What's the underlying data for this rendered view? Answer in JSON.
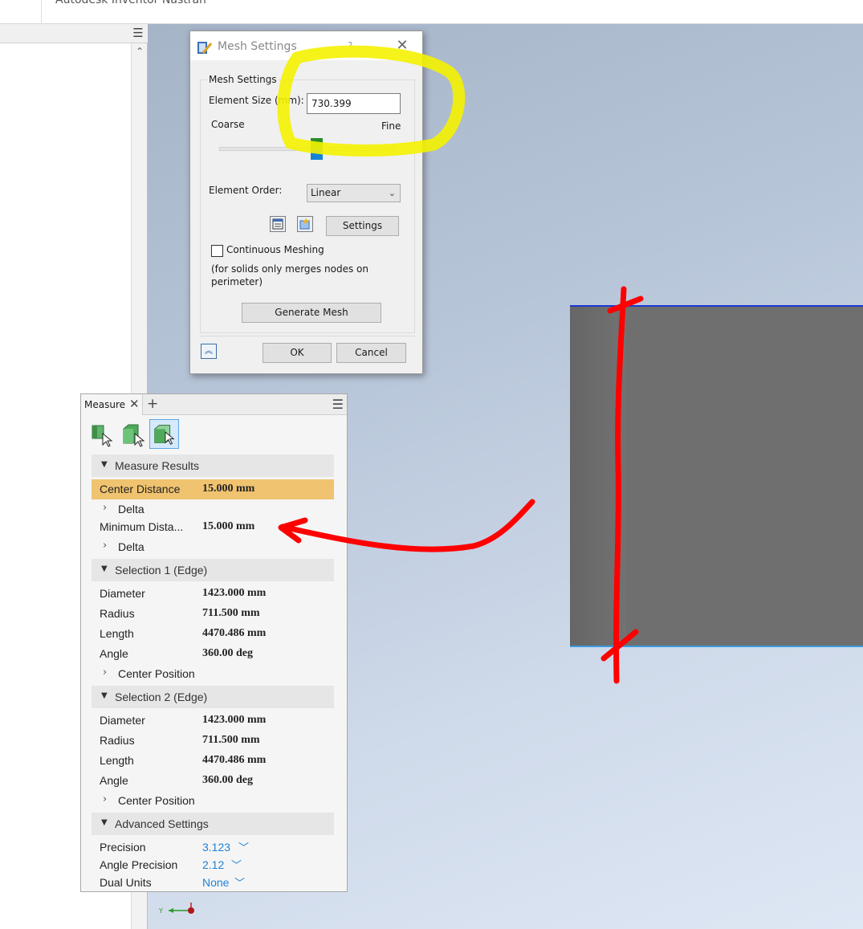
{
  "app": {
    "title": "Autodesk Inventor Nastran"
  },
  "browser": {
    "menu_icon": "hamburger-icon",
    "scroll_up_icon": "chevron-up-icon"
  },
  "mesh_dialog": {
    "title": "Mesh Settings",
    "help": "?",
    "group_label": "Mesh Settings",
    "element_size_label": "Element Size (mm):",
    "element_size_value": "730.399",
    "coarse_label": "Coarse",
    "fine_label": "Fine",
    "slider_level_percent": 55,
    "element_order_label": "Element Order:",
    "element_order_value": "Linear",
    "settings_button": "Settings",
    "continuous_meshing_label": "Continuous Meshing",
    "continuous_meshing_checked": false,
    "note_line1": "(for solids only merges nodes on",
    "note_line2": "perimeter)",
    "generate_button": "Generate Mesh",
    "ok_button": "OK",
    "cancel_button": "Cancel"
  },
  "measure_panel": {
    "tab_label": "Measure",
    "sections": {
      "results": "Measure Results",
      "selection1": "Selection 1 (Edge)",
      "selection2": "Selection 2 (Edge)",
      "advanced": "Advanced Settings"
    },
    "results": {
      "center_distance_label": "Center Distance",
      "center_distance_value": "15.000 mm",
      "delta_label": "Delta",
      "minimum_distance_label": "Minimum Dista...",
      "minimum_distance_value": "15.000 mm"
    },
    "selection1": {
      "diameter_label": "Diameter",
      "diameter_value": "1423.000 mm",
      "radius_label": "Radius",
      "radius_value": "711.500 mm",
      "length_label": "Length",
      "length_value": "4470.486 mm",
      "angle_label": "Angle",
      "angle_value": "360.00 deg",
      "center_position_label": "Center Position"
    },
    "selection2": {
      "diameter_label": "Diameter",
      "diameter_value": "1423.000 mm",
      "radius_label": "Radius",
      "radius_value": "711.500 mm",
      "length_label": "Length",
      "length_value": "4470.486 mm",
      "angle_label": "Angle",
      "angle_value": "360.00 deg",
      "center_position_label": "Center Position"
    },
    "advanced": {
      "precision_label": "Precision",
      "precision_value": "3.123",
      "angle_precision_label": "Angle Precision",
      "angle_precision_value": "2.12",
      "dual_units_label": "Dual Units",
      "dual_units_value": "None"
    }
  },
  "colors": {
    "highlight_row": "#efc36f",
    "link_blue": "#1e82d6",
    "annotation_red": "#ff0000",
    "annotation_yellow": "#f4f200",
    "part_gray": "#6f6f6f"
  }
}
